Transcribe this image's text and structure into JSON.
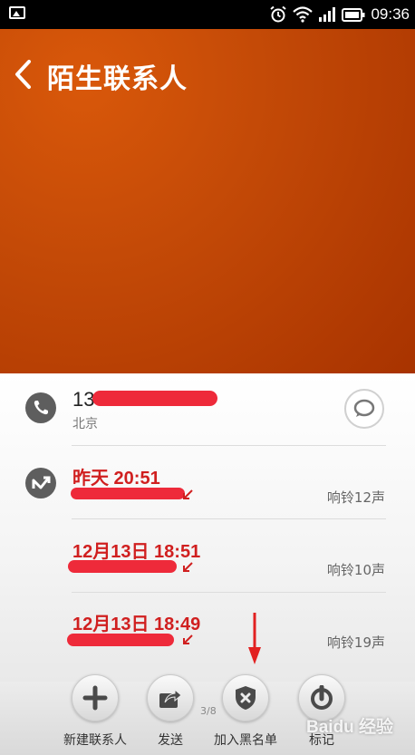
{
  "status_bar": {
    "time": "09:36"
  },
  "header": {
    "title": "陌生联系人"
  },
  "contact": {
    "number_prefix": "13",
    "location": "北京"
  },
  "calls": [
    {
      "time": "昨天 20:51",
      "ring": "响铃12声"
    },
    {
      "time": "12月13日 18:51",
      "ring": "响铃10声"
    },
    {
      "time": "12月13日 18:49",
      "ring": "响铃19声"
    }
  ],
  "page_indicator": "3/8",
  "actions": {
    "new_contact": "新建联系人",
    "send": "发送",
    "blacklist": "加入黑名单",
    "mark": "标记"
  },
  "watermark": "Baidu 经验",
  "colors": {
    "header": "#c44a07",
    "missed_call": "#d01f1f",
    "redaction": "#ee2a3a"
  }
}
